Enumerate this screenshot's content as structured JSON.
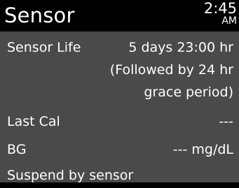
{
  "header": {
    "title": "Sensor",
    "time": "2:45",
    "ampm": "AM"
  },
  "rows": [
    {
      "label": "Sensor Life",
      "value": "5 days 23:00 hr"
    },
    {
      "label": "",
      "value": "(Followed by 24 hr"
    },
    {
      "label": "",
      "value": "grace period)"
    },
    {
      "label": "Last Cal",
      "value": "---"
    },
    {
      "label": "BG",
      "value": "--- mg/dL"
    },
    {
      "label": "Suspend by sensor",
      "value": ""
    }
  ],
  "colors": {
    "background": "#000000",
    "panel": "#4a4a4a",
    "text": "#ffffff"
  }
}
